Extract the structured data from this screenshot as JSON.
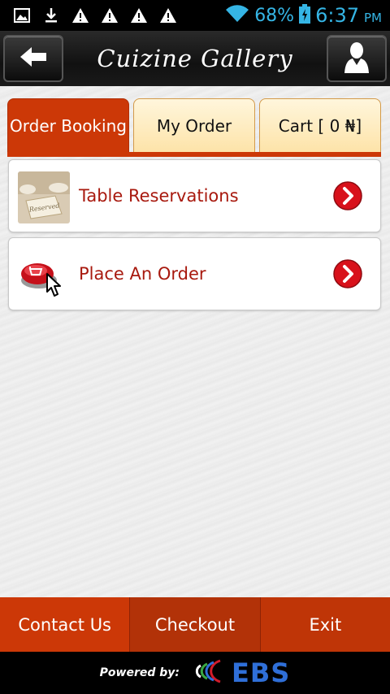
{
  "status_bar": {
    "battery": "68%",
    "time": "6:37",
    "ampm": "PM",
    "icons": [
      "gallery-icon",
      "download-icon",
      "warning-icon",
      "warning-icon",
      "warning-icon",
      "warning-icon",
      "wifi-icon",
      "battery-charging-icon"
    ]
  },
  "header": {
    "title": "Cuizine Gallery"
  },
  "tabs": [
    {
      "label": "Order Booking",
      "active": true
    },
    {
      "label": "My Order",
      "active": false
    },
    {
      "label": "Cart [ 0 ₦]",
      "active": false
    }
  ],
  "menu": [
    {
      "label": "Table Reservations",
      "thumb_text": "Reserved"
    },
    {
      "label": "Place An Order"
    }
  ],
  "bottom_nav": {
    "contact": "Contact Us",
    "checkout": "Checkout",
    "exit": "Exit"
  },
  "footer": {
    "powered_by": "Powered by:",
    "brand": "EBS"
  },
  "colors": {
    "accent": "#cc3807",
    "label_red": "#a8190e",
    "tab_inactive": "#fde3a8",
    "status_blue": "#35b5e5",
    "brand_blue": "#2f6fd8"
  }
}
